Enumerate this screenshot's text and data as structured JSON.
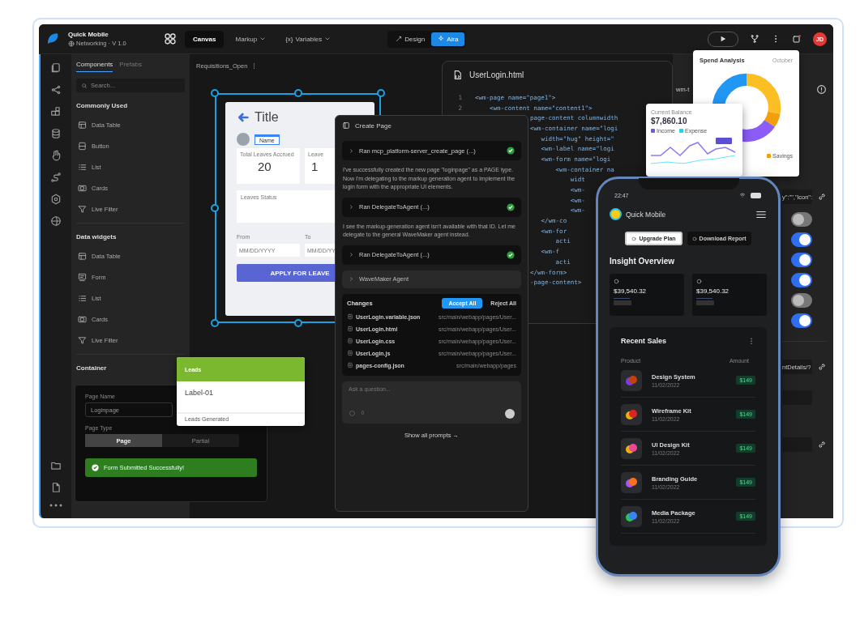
{
  "app": {
    "name": "Quick Mobile",
    "project": "Networking · V 1.0",
    "avatar": "JD"
  },
  "view_tabs": [
    {
      "label": "Canvas",
      "selected": true,
      "dropdown": false
    },
    {
      "label": "Markup",
      "selected": false,
      "dropdown": true
    },
    {
      "label": "Variables",
      "prefix": "{x}",
      "selected": false,
      "dropdown": true
    }
  ],
  "mode_toggle": [
    {
      "label": "Design",
      "selected": false
    },
    {
      "label": "Aira",
      "selected": true
    }
  ],
  "left_panel": {
    "tabs": [
      {
        "label": "Components",
        "selected": true
      },
      {
        "label": "Prefabs",
        "selected": false
      }
    ],
    "search": {
      "placeholder": "Search..."
    },
    "sections": [
      {
        "title": "Commonly Used",
        "items": [
          {
            "label": "Data Table",
            "kind": "table"
          },
          {
            "label": "Button",
            "kind": "button"
          },
          {
            "label": "List",
            "kind": "list"
          },
          {
            "label": "Cards",
            "kind": "cards"
          },
          {
            "label": "Live Filter",
            "kind": "filter"
          }
        ]
      },
      {
        "title": "Data widgets",
        "items": [
          {
            "label": "Data Table",
            "kind": "table"
          },
          {
            "label": "Form",
            "kind": "form"
          },
          {
            "label": "List",
            "kind": "list"
          },
          {
            "label": "Cards",
            "kind": "cards"
          },
          {
            "label": "Live Filter",
            "kind": "filter"
          }
        ]
      }
    ],
    "container_title": "Container"
  },
  "canvas": {
    "page_tab": "Requisitions_Open",
    "preview": {
      "title": "Title",
      "badge": "Name",
      "stats": [
        {
          "label": "Total Leaves Accrued",
          "value": "20"
        },
        {
          "label": "Leave",
          "value": "1"
        }
      ],
      "status_label": "Leaves Status",
      "date_fields": [
        {
          "label": "From",
          "placeholder": "MM/DD/YYYY"
        },
        {
          "label": "To",
          "placeholder": "MM/DD/YY"
        }
      ],
      "button": "APPLY FOR LEAVE"
    }
  },
  "widget_card": {
    "header": "Leads",
    "label": "Label-01",
    "caption": "Leads Generated"
  },
  "container_panel": {
    "page_name_label": "Page Name",
    "page_name": "Loginpage",
    "page_type_label": "Page Type",
    "page_types": [
      {
        "label": "Page",
        "selected": true
      },
      {
        "label": "Partial",
        "selected": false
      }
    ],
    "toast": "Form Submitted Successfully!"
  },
  "code_editor": {
    "file": "UserLogin.html",
    "lines": [
      {
        "number": "1",
        "code": "<wm-page name=\"page1\">"
      },
      {
        "number": "2",
        "code": "    <wm-content name=\"content1\">"
      }
    ],
    "covered_lines": [
      "page-content columnwidth",
      "<wm-container name=\"logi",
      "   width=\"hug\" height=\"",
      "   <wm-label name=\"logi",
      "   <wm-form name=\"logi",
      "       <wm-container na",
      "           widt",
      "           <wm-",
      "           <wm-",
      "           <wm-",
      "   </wm-co",
      "   <wm-for",
      "       acti",
      "   <wm-f",
      "       acti",
      "</wm-form>",
      "-page-content>"
    ]
  },
  "chat": {
    "title": "Create Page",
    "steps": [
      {
        "kind": "tool",
        "text": "Ran mcp_platform-server_create_page (...)",
        "done": true
      },
      {
        "kind": "message",
        "text": "I've successfully created the new page \"loginpage\" as a PAGE type. Now I'm delegating to the markup generation agent to implement the login form with the appropriate UI elements."
      },
      {
        "kind": "tool",
        "text": "Ran DelegateToAgent (...)",
        "done": true
      },
      {
        "kind": "message",
        "text": "I see the markup-generation agent isn't available with that ID. Let me delegate to the general WaveMaker agent instead."
      },
      {
        "kind": "tool",
        "text": "Ran DelegateToAgent (...)",
        "done": true
      },
      {
        "kind": "agent",
        "text": "WaveMaker Agent"
      }
    ],
    "changes": {
      "title": "Changes",
      "accept": "Accept All",
      "reject": "Reject All",
      "files": [
        {
          "name": "UserLogin.variable.json",
          "path": "src/main/webapp/pages/User..."
        },
        {
          "name": "UserLogin.html",
          "path": "src/main/webapp/pages/User..."
        },
        {
          "name": "UserLogin.css",
          "path": "src/main/webapp/pages/User..."
        },
        {
          "name": "UserLogin.js",
          "path": "src/main/webapp/pages/User..."
        },
        {
          "name": "pages-config.json",
          "path": "src/main/webapp/pages"
        }
      ]
    },
    "input": {
      "placeholder": "Ask a question..."
    },
    "footer": "Show all prompts →"
  },
  "right_panel": {
    "header": "wm-t",
    "expression_fields": [
      "y\":\"\",\"icon\":",
      "ntDetails/?"
    ],
    "toggles": [
      {
        "on": false
      },
      {
        "on": true
      },
      {
        "on": true
      },
      {
        "on": true
      },
      {
        "on": false
      },
      {
        "on": true
      }
    ]
  },
  "spend_card": {
    "title": "Spend Analysis",
    "period": "October",
    "legend": [
      "Savings"
    ]
  },
  "balance_card": {
    "title": "Current Balance",
    "amount": "$7,860.10",
    "legend": [
      "Income",
      "Expense"
    ]
  },
  "phone": {
    "time": "22:47",
    "app_name": "Quick Mobile",
    "buttons": [
      {
        "label": "Upgrade Plan",
        "kind": "primary"
      },
      {
        "label": "Download Report",
        "kind": "secondary"
      }
    ],
    "title": "Insight Overview",
    "stats": [
      "$39,540.32",
      "$39,540.32"
    ],
    "sales": {
      "title": "Recent Sales",
      "columns": [
        "Product",
        "Amount"
      ],
      "rows": [
        {
          "name": "Design System",
          "date": "11/02/2022",
          "amount": "$149"
        },
        {
          "name": "Wireframe Kit",
          "date": "11/02/2022",
          "amount": "$149"
        },
        {
          "name": "UI Design Kit",
          "date": "11/02/2022",
          "amount": "$149"
        },
        {
          "name": "Branding Guide",
          "date": "11/02/2022",
          "amount": "$149"
        },
        {
          "name": "Media Package",
          "date": "11/02/2022",
          "amount": "$149"
        }
      ]
    }
  }
}
